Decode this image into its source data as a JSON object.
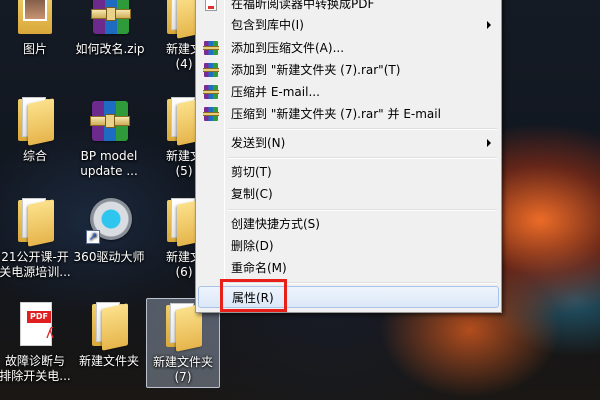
{
  "desktop": {
    "icons": [
      {
        "label": "图片",
        "icon": "pictures-folder-icon"
      },
      {
        "label": "如何改名.zip",
        "icon": "winrar-archive-icon"
      },
      {
        "label": "新建文\n(4)",
        "icon": "folder-icon"
      },
      {
        "label": "综合",
        "icon": "folder-icon"
      },
      {
        "label": "BP model\nupdate ...",
        "icon": "winrar-archive-icon"
      },
      {
        "label": "新建文\n(5)",
        "icon": "folder-icon"
      },
      {
        "label": "21公开课-开\n关电源培训...",
        "icon": "folder-icon"
      },
      {
        "label": "360驱动大师",
        "icon": "gear-icon"
      },
      {
        "label": "新建文\n(6)",
        "icon": "folder-icon"
      },
      {
        "label": "故障诊断与\n排除开关电...",
        "icon": "pdf-icon"
      },
      {
        "label": "新建文件夹",
        "icon": "folder-icon"
      },
      {
        "label": "新建文件夹\n(7)",
        "icon": "folder-icon"
      }
    ]
  },
  "context_menu": {
    "items": {
      "convert_pdf": "在福昕阅读器中转换成PDF",
      "include_library": "包含到库中(I)",
      "add_archive": "添加到压缩文件(A)...",
      "add_rar": "添加到 \"新建文件夹 (7).rar\"(T)",
      "compress_email": "压缩并 E-mail...",
      "compress_rar_email": "压缩到 \"新建文件夹 (7).rar\" 并 E-mail",
      "send_to": "发送到(N)",
      "cut": "剪切(T)",
      "copy": "复制(C)",
      "create_shortcut": "创建快捷方式(S)",
      "delete": "删除(D)",
      "rename": "重命名(M)",
      "properties": "属性(R)"
    }
  },
  "annotation": {
    "highlight_color": "#e8201a"
  }
}
